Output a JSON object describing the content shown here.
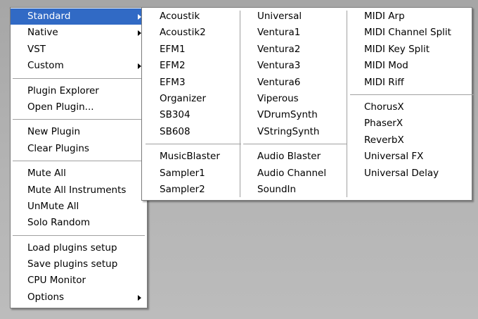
{
  "main_menu": {
    "items": [
      {
        "label": "Standard",
        "submenu": true,
        "selected": true
      },
      {
        "label": "Native",
        "submenu": true
      },
      {
        "label": "VST",
        "submenu": false
      },
      {
        "label": "Custom",
        "submenu": true
      },
      {
        "separator": true
      },
      {
        "label": "Plugin Explorer"
      },
      {
        "label": "Open Plugin..."
      },
      {
        "separator": true
      },
      {
        "label": "New Plugin"
      },
      {
        "label": "Clear Plugins"
      },
      {
        "separator": true
      },
      {
        "label": "Mute All"
      },
      {
        "label": "Mute All Instruments"
      },
      {
        "label": "UnMute All"
      },
      {
        "label": "Solo Random"
      },
      {
        "separator": true
      },
      {
        "label": "Load plugins setup"
      },
      {
        "label": "Save plugins setup"
      },
      {
        "label": "CPU Monitor"
      },
      {
        "label": "Options",
        "submenu": true
      }
    ]
  },
  "standard_submenu": {
    "columns": [
      {
        "group1": [
          "Acoustik",
          "Acoustik2",
          "EFM1",
          "EFM2",
          "EFM3",
          "Organizer",
          "SB304",
          "SB608"
        ],
        "group2": [
          "MusicBlaster",
          "Sampler1",
          "Sampler2"
        ]
      },
      {
        "group1": [
          "Universal",
          "Ventura1",
          "Ventura2",
          "Ventura3",
          "Ventura6",
          "Viperous",
          "VDrumSynth",
          "VStringSynth"
        ],
        "group2": [
          "Audio Blaster",
          "Audio Channel",
          "SoundIn"
        ]
      },
      {
        "group1": [
          "MIDI Arp",
          "MIDI Channel Split",
          "MIDI Key Split",
          "MIDI Mod",
          "MIDI Riff"
        ],
        "group2": [
          "ChorusX",
          "PhaserX",
          "ReverbX",
          "Universal FX",
          "Universal Delay"
        ]
      }
    ]
  },
  "colors": {
    "highlight": "#316ac5",
    "highlight_text": "#ffffff",
    "desktop_bg": "#b0b0b0"
  }
}
